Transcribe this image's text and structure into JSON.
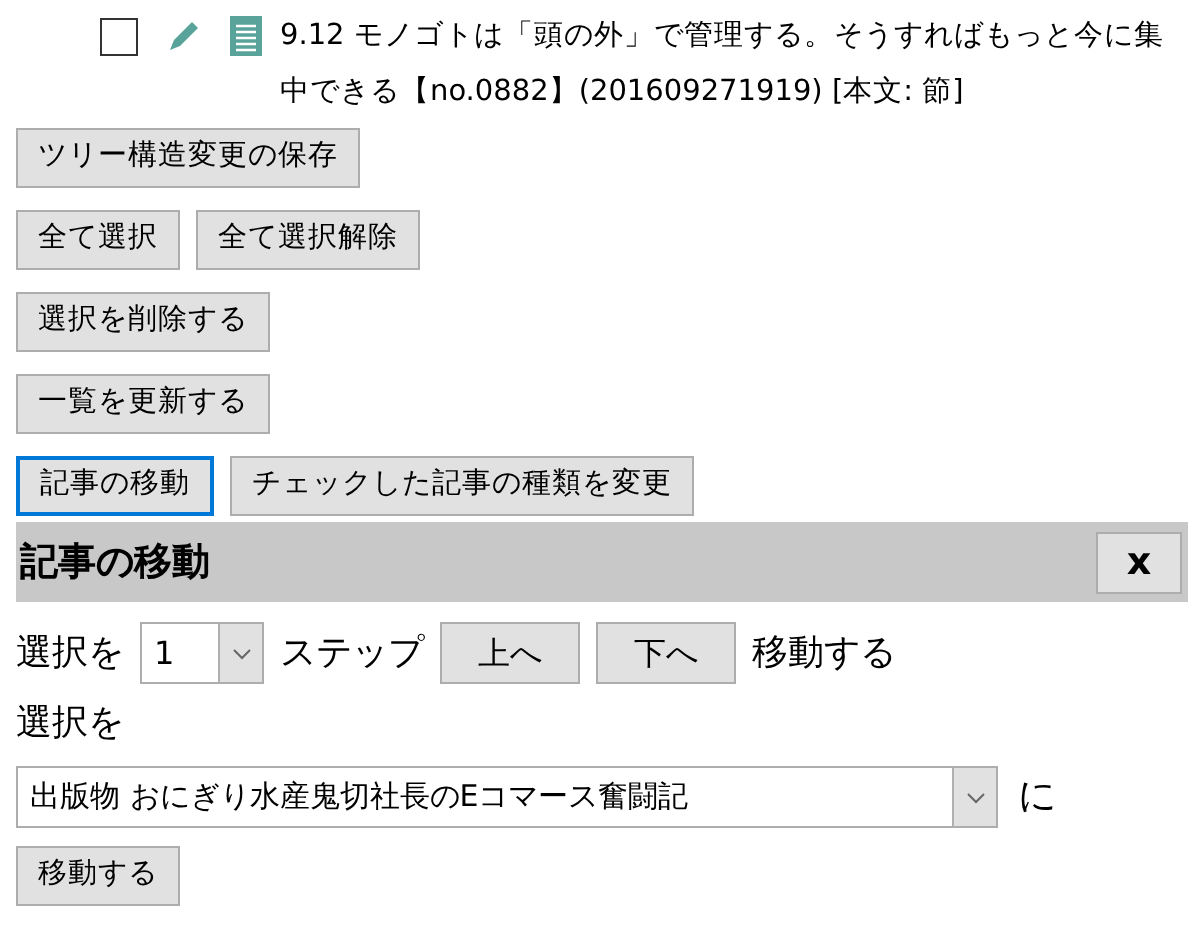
{
  "article_item": {
    "checked": false,
    "text": "9.12 モノゴトは「頭の外」で管理する。そうすればもっと今に集中できる【no.0882】(201609271919) [本文: 節]"
  },
  "button_rows": [
    [
      {
        "label": "ツリー構造変更の保存",
        "focused": false
      }
    ],
    [
      {
        "label": "全て選択",
        "focused": false
      },
      {
        "label": "全て選択解除",
        "focused": false
      }
    ],
    [
      {
        "label": "選択を削除する",
        "focused": false
      }
    ],
    [
      {
        "label": "一覧を更新する",
        "focused": false
      }
    ],
    [
      {
        "label": "記事の移動",
        "focused": true
      },
      {
        "label": "チェックした記事の種類を変更",
        "focused": false
      }
    ]
  ],
  "move_panel": {
    "title": "記事の移動",
    "close_label": "x",
    "step_row": {
      "prefix": "選択を",
      "step_value": "1",
      "step_label": "ステップ",
      "up_button": "上へ",
      "down_button": "下へ",
      "suffix": "移動する"
    },
    "target_label": "選択を",
    "target_select": {
      "value": "出版物 おにぎり水産鬼切社長のEコマース奮闘記",
      "suffix": "に"
    },
    "move_button": "移動する"
  }
}
